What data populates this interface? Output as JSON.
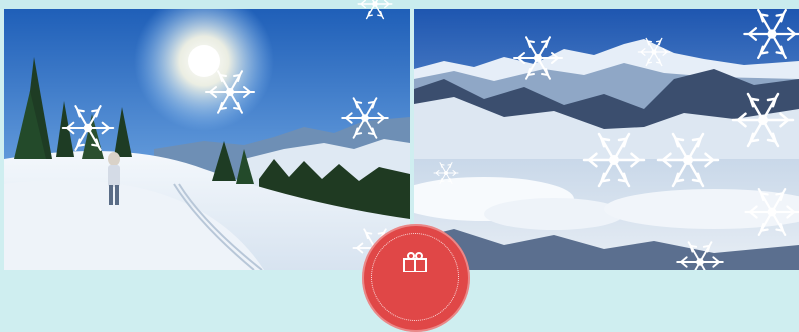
{
  "banner": {
    "left_photo": {
      "icon": "snowy-slope-hiker-photo",
      "colors": {
        "sky_top": "#1f5fb8",
        "sky_bottom": "#8fc2f2",
        "snow": "#f4f8fc",
        "forest": "#1f3a22"
      }
    },
    "right_photo": {
      "icon": "alpine-mountain-panorama-photo",
      "colors": {
        "sky_top": "#1e56b0",
        "sky_bottom": "#a9cdef",
        "rock": "#3b4e6e",
        "fog": "#e8eef5"
      }
    },
    "snowflake_icon": "snowflake-icon",
    "badge": {
      "icon": "gift-icon",
      "colors": {
        "fill": "#e04747",
        "ring": "#ffffff"
      }
    }
  }
}
